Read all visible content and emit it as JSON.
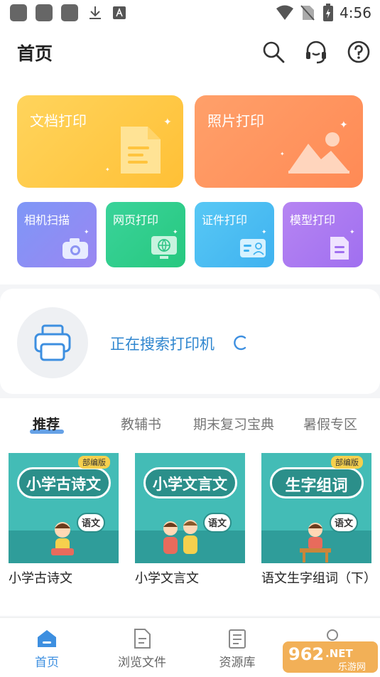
{
  "status_bar": {
    "time": "4:56"
  },
  "header": {
    "title": "首页"
  },
  "cards": {
    "doc_print": "文档打印",
    "photo_print": "照片打印",
    "camera_scan": "相机扫描",
    "web_print": "网页打印",
    "id_print": "证件打印",
    "model_print": "模型打印"
  },
  "printer_search": {
    "status_text": "正在搜索打印机"
  },
  "tabs": [
    "推荐",
    "教辅书",
    "期末复习宝典",
    "暑假专区"
  ],
  "books": [
    {
      "title": "小学古诗文",
      "cover_text": "小学古诗文",
      "badge": "部编版",
      "tag": "语文"
    },
    {
      "title": "小学文言文",
      "cover_text": "小学文言文",
      "badge": "",
      "tag": "语文"
    },
    {
      "title": "语文生字组词（下）",
      "cover_text": "生字组词",
      "badge": "部编版",
      "tag": "语文"
    }
  ],
  "bottom_nav": {
    "home": "首页",
    "browse_files": "浏览文件",
    "resource_library": "资源库"
  },
  "watermark": {
    "text": "962.NET",
    "sub": "乐游网"
  },
  "colors": {
    "accent": "#3d8fe0",
    "doc_card": "#ffc94d",
    "photo_card": "#ff9a63",
    "scan_card": "#7f9cf5",
    "web_card": "#33d190",
    "id_card": "#4fc3f7",
    "model_card": "#b07ef0",
    "book_teal": "#3fb8b3"
  }
}
